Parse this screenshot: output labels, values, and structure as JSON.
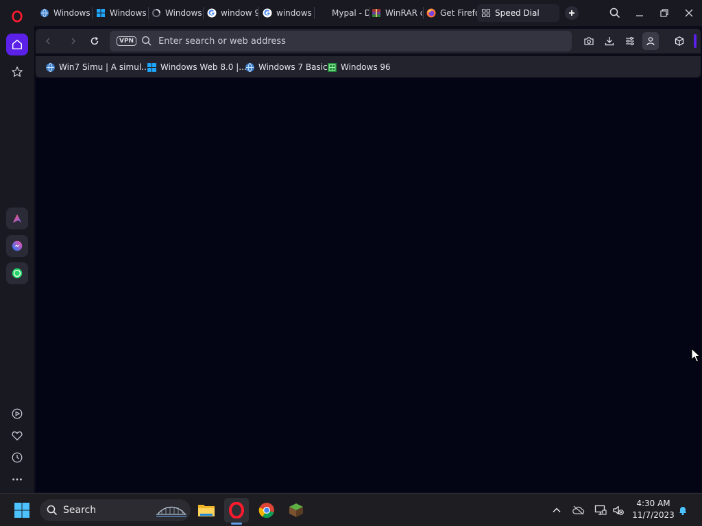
{
  "browser": {
    "tabs": [
      {
        "label": "Windows",
        "icon": "win7-globe-icon"
      },
      {
        "label": "Windows",
        "icon": "windows-logo-icon"
      },
      {
        "label": "Windows",
        "icon": "loading-spinner-icon"
      },
      {
        "label": "window 9",
        "icon": "google-g-icon"
      },
      {
        "label": "windows",
        "icon": "google-g-icon"
      },
      {
        "label": "Mypal - D",
        "icon": "blank-page-icon"
      },
      {
        "label": "WinRAR c",
        "icon": "winrar-icon"
      },
      {
        "label": "Get Firefo",
        "icon": "firefox-icon"
      },
      {
        "label": "Speed Dial",
        "icon": "speed-dial-grid-icon",
        "active": true
      }
    ],
    "address_bar": {
      "vpn_label": "VPN",
      "placeholder": "Enter search or web address",
      "value": ""
    },
    "bookmarks": [
      {
        "label": "Win7 Simu | A simul...",
        "icon": "win7-globe-icon"
      },
      {
        "label": "Windows Web 8.0 |...",
        "icon": "windows-logo-icon"
      },
      {
        "label": "Windows 7 Basic",
        "icon": "win7-globe-icon"
      },
      {
        "label": "Windows 96",
        "icon": "windows96-icon"
      }
    ],
    "sidebar_items": [
      "opera-logo-icon",
      "home-icon",
      "star-icon",
      "aria-icon",
      "messenger-icon",
      "whatsapp-icon",
      "player-icon",
      "heart-icon",
      "history-icon",
      "more-icon"
    ],
    "accent_color": "#5b21e8"
  },
  "taskbar": {
    "search_label": "Search",
    "apps": [
      "start-icon",
      "file-explorer-icon",
      "opera-icon",
      "chrome-icon",
      "minecraft-icon"
    ],
    "tray": [
      "chevron-up-icon",
      "onedrive-offline-icon",
      "display-icon",
      "volume-muted-icon",
      "notification-bell-icon"
    ],
    "time": "4:30 AM",
    "date": "11/7/2023"
  }
}
